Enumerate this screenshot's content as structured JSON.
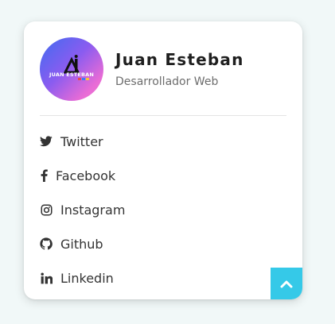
{
  "profile": {
    "name": "Juan Esteban",
    "role": "Desarrollador Web",
    "avatar_text": "JUAN ESTEBAN"
  },
  "links": [
    {
      "label": "Twitter",
      "icon": "twitter-icon"
    },
    {
      "label": "Facebook",
      "icon": "facebook-icon"
    },
    {
      "label": "Instagram",
      "icon": "instagram-icon"
    },
    {
      "label": "Github",
      "icon": "github-icon"
    },
    {
      "label": "Linkedin",
      "icon": "linkedin-icon"
    }
  ],
  "scroll_top": {
    "icon": "chevron-up-icon"
  },
  "colors": {
    "background": "#f1f8f8",
    "card": "#ffffff",
    "accent": "#35c9e8",
    "avatar_gradient_start": "#3f6cf0",
    "avatar_gradient_end": "#f07ad0"
  }
}
